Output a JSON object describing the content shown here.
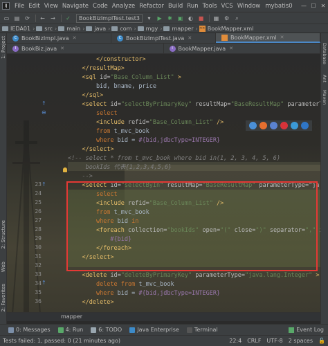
{
  "menubar": {
    "items": [
      "File",
      "Edit",
      "View",
      "Navigate",
      "Code",
      "Analyze",
      "Refactor",
      "Build",
      "Run",
      "Tools",
      "VCS",
      "Window"
    ],
    "title": "mybatis0"
  },
  "toolbar": {
    "run_config": "BookBizImplTest.test3"
  },
  "breadcrumbs": [
    "IEDA01",
    "src",
    "main",
    "java",
    "com",
    "mgy",
    "mapper",
    "BookMapper.xml"
  ],
  "tabs_row1": [
    {
      "label": "BookBizImpl.java",
      "icon": "class-icon"
    },
    {
      "label": "BookBizImplTest.java",
      "icon": "class-icon"
    },
    {
      "label": "BookMapper.xml",
      "icon": "xml-icon",
      "active": true
    }
  ],
  "tabs_row2": [
    {
      "label": "BookBiz.java",
      "icon": "class-icon"
    },
    {
      "label": "BookMapper.java",
      "icon": "class-icon"
    }
  ],
  "left_panels": [
    "1: Project",
    "2: Structure",
    "Web",
    "2: Favorites"
  ],
  "right_panels": [
    "Database",
    "Ant",
    "Maven"
  ],
  "editor": {
    "line_numbers": [
      "",
      "",
      "",
      "",
      "",
      "",
      "",
      "",
      "",
      "",
      "",
      "",
      "",
      "",
      "23",
      "24",
      "25",
      "26",
      "27",
      "28",
      "29",
      "30",
      "31",
      "32",
      "33",
      "34",
      "35",
      "36"
    ],
    "code_lines": [
      "        </constructor>",
      "    </resultMap>",
      "    <sql id=\"Base_Column_List\" >",
      "        bid, bname, price",
      "    </sql>",
      "    <select id=\"selectByPrimaryKey\" resultMap=\"BaseResultMap\" parameterT",
      "        select",
      "        <include refid=\"Base_Column_List\" />",
      "        from t_mvc_book",
      "        where bid = #{bid,jdbcType=INTEGER}",
      "    </select>",
      "<!-- select * from t_mvc_book where bid in(1, 2, 3, 4, 5, 6)",
      "     bookIds 代表{1,2,3,4,5,6}",
      "    -->",
      "    <select id=\"selectByIn\" resultMap=\"BaseResultMap\" parameterType=\"ja",
      "        select",
      "        <include refid=\"Base_Column_List\" />",
      "        from t_mvc_book",
      "        where bid in",
      "        <foreach collection=\"bookIds\" open=\"(\" close=\")\" separator=\",\" ite",
      "            #{bid}",
      "        </foreach>",
      "    </select>",
      "",
      "    <delete id=\"deleteByPrimaryKey\" parameterType=\"java.lang.Integer\" >",
      "        delete from t_mvc_book",
      "        where bid = #{bid,jdbcType=INTEGER}",
      "    </delete>"
    ]
  },
  "bottom_crumb": "mapper",
  "toolwindows": {
    "items": [
      "0: Messages",
      "4: Run",
      "6: TODO",
      "Java Enterprise",
      "Terminal"
    ],
    "event_log": "Event Log"
  },
  "status": {
    "message": "Tests failed: 1, passed: 0 (21 minutes ago)",
    "position": "22:4",
    "line_sep": "CRLF",
    "encoding": "UTF-8",
    "indent": "2 spaces"
  }
}
